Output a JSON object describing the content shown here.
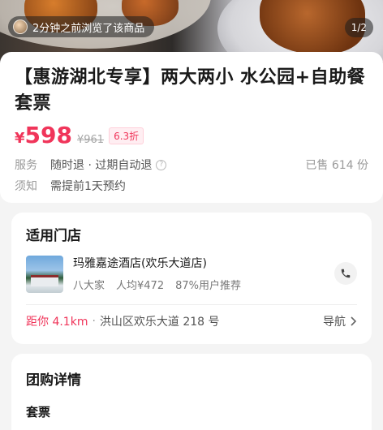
{
  "hero": {
    "view_badge_text": "2分钟之前浏览了该商品",
    "image_counter": "1/2"
  },
  "product": {
    "title": "【惠游湖北专享】两大两小 水公园+自助餐套票",
    "price_symbol": "¥",
    "price": "598",
    "original_price": "¥961",
    "discount": "6.3折",
    "service_label": "服务",
    "service_value": "随时退 · 过期自动退",
    "sold_text": "已售 614 份",
    "notice_label": "须知",
    "notice_value": "需提前1天预约"
  },
  "store_section": {
    "title": "适用门店",
    "store_name": "玛雅嘉途酒店(欢乐大道店)",
    "meta": [
      "八大家",
      "人均¥472",
      "87%用户推荐"
    ],
    "distance": "距你 4.1km",
    "address": "洪山区欢乐大道 218 号",
    "nav_label": "导航"
  },
  "detail_section": {
    "title": "团购详情",
    "subtitle": "套票"
  },
  "colors": {
    "accent": "#f0355a",
    "background": "#f4f4f4"
  },
  "icons": [
    "avatar-icon",
    "help-icon",
    "phone-icon",
    "chevron-right-icon"
  ]
}
